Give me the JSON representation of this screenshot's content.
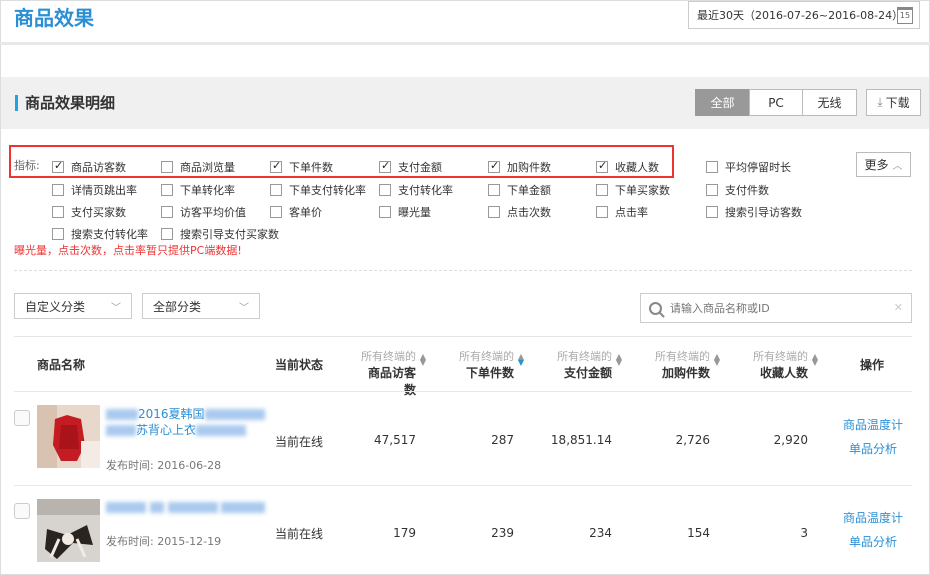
{
  "header": {
    "title": "商品效果",
    "date_range": "最近30天（2016-07-26~2016-08-24）",
    "calendar_day": "15"
  },
  "section": {
    "title": "商品效果明细",
    "tabs": [
      {
        "label": "全部",
        "active": true
      },
      {
        "label": "PC",
        "active": false
      },
      {
        "label": "无线",
        "active": false
      }
    ],
    "download_label": "下载"
  },
  "metrics": {
    "label": "指标:",
    "items": [
      {
        "label": "商品访客数",
        "checked": true
      },
      {
        "label": "商品浏览量",
        "checked": false
      },
      {
        "label": "下单件数",
        "checked": true
      },
      {
        "label": "支付金额",
        "checked": true
      },
      {
        "label": "加购件数",
        "checked": true
      },
      {
        "label": "收藏人数",
        "checked": true
      },
      {
        "label": "平均停留时长",
        "checked": false
      },
      {
        "label": "详情页跳出率",
        "checked": false
      },
      {
        "label": "下单转化率",
        "checked": false
      },
      {
        "label": "下单支付转化率",
        "checked": false
      },
      {
        "label": "支付转化率",
        "checked": false
      },
      {
        "label": "下单金额",
        "checked": false
      },
      {
        "label": "下单买家数",
        "checked": false
      },
      {
        "label": "支付件数",
        "checked": false
      },
      {
        "label": "支付买家数",
        "checked": false
      },
      {
        "label": "访客平均价值",
        "checked": false
      },
      {
        "label": "客单价",
        "checked": false
      },
      {
        "label": "曝光量",
        "checked": false
      },
      {
        "label": "点击次数",
        "checked": false
      },
      {
        "label": "点击率",
        "checked": false
      },
      {
        "label": "搜索引导访客数",
        "checked": false
      },
      {
        "label": "搜索支付转化率",
        "checked": false
      },
      {
        "label": "搜索引导支付买家数",
        "checked": false
      }
    ],
    "more_label": "更多",
    "warning": "曝光量，点击次数，点击率暂只提供PC端数据!"
  },
  "filters": {
    "custom_category": "自定义分类",
    "all_category": "全部分类",
    "search_placeholder": "请输入商品名称或ID"
  },
  "table": {
    "columns": {
      "name": "商品名称",
      "status": "当前状态",
      "visitors_sub": "所有终端的",
      "visitors": "商品访客数",
      "orders_sub": "所有终端的",
      "orders": "下单件数",
      "payment_sub": "所有终端的",
      "payment": "支付金额",
      "cart_sub": "所有终端的",
      "cart": "加购件数",
      "fav_sub": "所有终端的",
      "fav": "收藏人数",
      "action": "操作"
    },
    "rows": [
      {
        "name_line1": "2016夏韩国",
        "name_line2": "苏背心上衣",
        "publish": "发布时间: 2016-06-28",
        "status": "当前在线",
        "visitors": "47,517",
        "orders": "287",
        "payment": "18,851.14",
        "cart": "2,726",
        "fav": "2,920",
        "action1": "商品温度计",
        "action2": "单品分析"
      },
      {
        "name_line1": "",
        "name_line2": "",
        "publish": "发布时间: 2015-12-19",
        "status": "当前在线",
        "visitors": "179",
        "orders": "239",
        "payment": "234",
        "cart": "154",
        "fav": "3",
        "action1": "商品温度计",
        "action2": "单品分析"
      }
    ]
  }
}
